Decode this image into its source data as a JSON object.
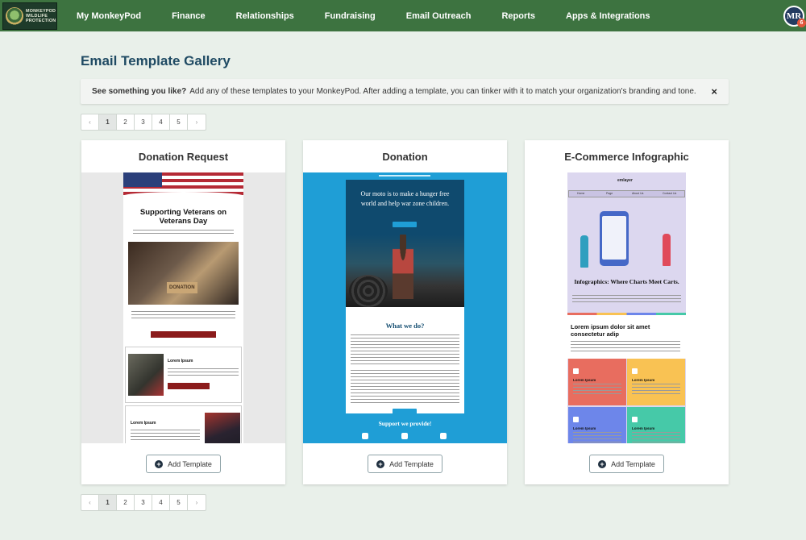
{
  "nav": {
    "logo_text": [
      "MONKEYPOD",
      "WILDLIFE",
      "PROTECTION"
    ],
    "items": [
      "My MonkeyPod",
      "Finance",
      "Relationships",
      "Fundraising",
      "Email Outreach",
      "Reports",
      "Apps & Integrations"
    ],
    "avatar_initials": "MR",
    "notification_count": "6"
  },
  "page": {
    "title": "Email Template Gallery",
    "notice_bold": "See something you like?",
    "notice_text": "Add any of these templates to your MonkeyPod. After adding a template, you can tinker with it to match your organization's branding and tone.",
    "close_glyph": "×"
  },
  "pagination": {
    "prev": "‹",
    "next": "›",
    "pages": [
      "1",
      "2",
      "3",
      "4",
      "5"
    ],
    "active": "1"
  },
  "cards": [
    {
      "title": "Donation Request",
      "button": "Add Template",
      "preview": {
        "heading": "Supporting Veterans on Veterans Day",
        "sub1_title": "Lorem Ipsum",
        "sub2_title": "Lorem Ipsum"
      }
    },
    {
      "title": "Donation",
      "button": "Add Template",
      "preview": {
        "hero_text": "Our moto is to make a hunger free world and help war zone children.",
        "section_title": "What we do?",
        "footer_title": "Support we provide!"
      }
    },
    {
      "title": "E-Commerce Infographic",
      "button": "Add Template",
      "preview": {
        "brand": "emlayer",
        "menu": [
          "Home",
          "Page",
          "About Us",
          "Contact Us"
        ],
        "info_title": "Infographics: Where Charts Meet Carts.",
        "section_title": "Lorem ipsum dolor sit amet consectetur adip",
        "tiles": [
          "Lorem Ipsum",
          "Lorem Ipsum",
          "Lorem Ipsum",
          "Lorem Ipsum"
        ]
      }
    }
  ],
  "colors": {
    "nav_bg": "#3d7340",
    "page_bg": "#e9f0ea",
    "title": "#1f4a63",
    "tile_red": "#e86d5f",
    "tile_yellow": "#f9c253",
    "tile_blue": "#6d86ea",
    "tile_teal": "#46c9a8"
  },
  "icons": [
    "plus-circle-icon",
    "close-icon",
    "chevron-left-icon",
    "chevron-right-icon"
  ]
}
